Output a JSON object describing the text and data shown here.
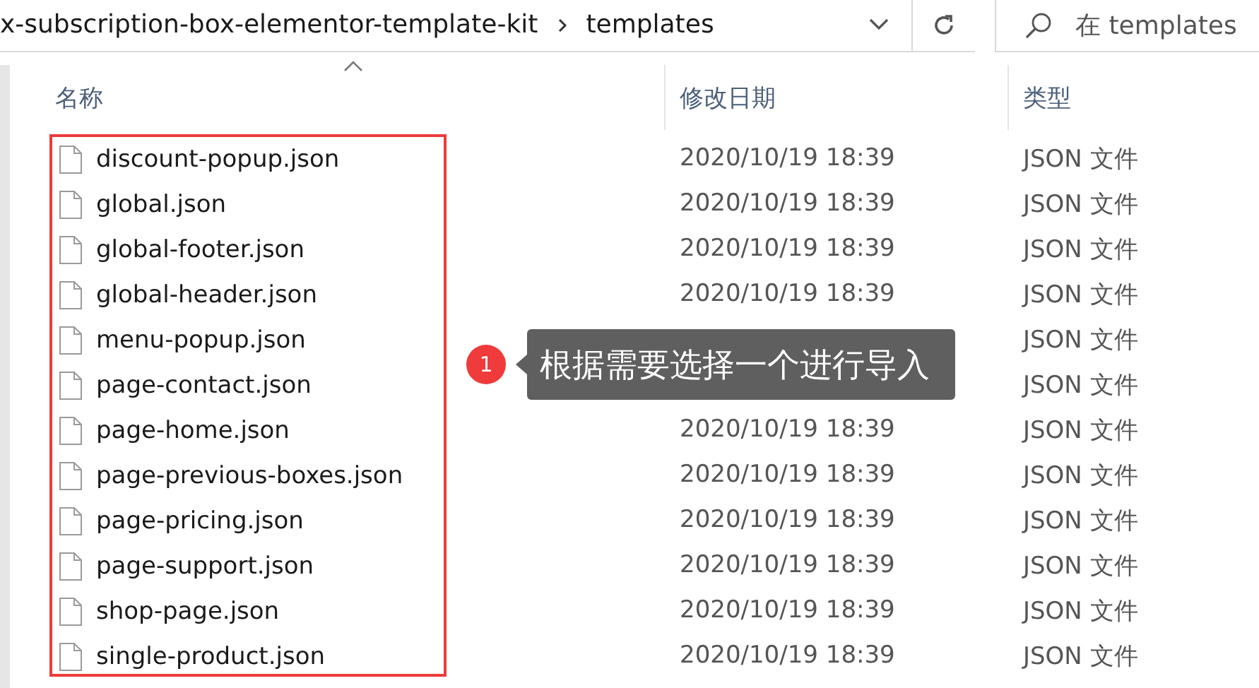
{
  "address_bar": {
    "path": [
      {
        "label": "x-subscription-box-elementor-template-kit"
      },
      {
        "label": "templates"
      }
    ]
  },
  "search": {
    "placeholder": "在 templates"
  },
  "columns": [
    {
      "label": "名称",
      "sorted": true
    },
    {
      "label": "修改日期",
      "sorted": false
    },
    {
      "label": "类型",
      "sorted": false
    }
  ],
  "files": [
    {
      "name": "discount-popup.json",
      "modified": "2020/10/19 18:39",
      "type": "JSON 文件"
    },
    {
      "name": "global.json",
      "modified": "2020/10/19 18:39",
      "type": "JSON 文件"
    },
    {
      "name": "global-footer.json",
      "modified": "2020/10/19 18:39",
      "type": "JSON 文件"
    },
    {
      "name": "global-header.json",
      "modified": "2020/10/19 18:39",
      "type": "JSON 文件"
    },
    {
      "name": "menu-popup.json",
      "type": "JSON 文件"
    },
    {
      "name": "page-contact.json",
      "type": "JSON 文件"
    },
    {
      "name": "page-home.json",
      "modified": "2020/10/19 18:39",
      "type": "JSON 文件"
    },
    {
      "name": "page-previous-boxes.json",
      "modified": "2020/10/19 18:39",
      "type": "JSON 文件"
    },
    {
      "name": "page-pricing.json",
      "modified": "2020/10/19 18:39",
      "type": "JSON 文件"
    },
    {
      "name": "page-support.json",
      "modified": "2020/10/19 18:39",
      "type": "JSON 文件"
    },
    {
      "name": "shop-page.json",
      "modified": "2020/10/19 18:39",
      "type": "JSON 文件"
    },
    {
      "name": "single-product.json",
      "modified": "2020/10/19 18:39",
      "type": "JSON 文件"
    }
  ],
  "annotation": {
    "number": "1",
    "text": "根据需要选择一个进行导入"
  }
}
